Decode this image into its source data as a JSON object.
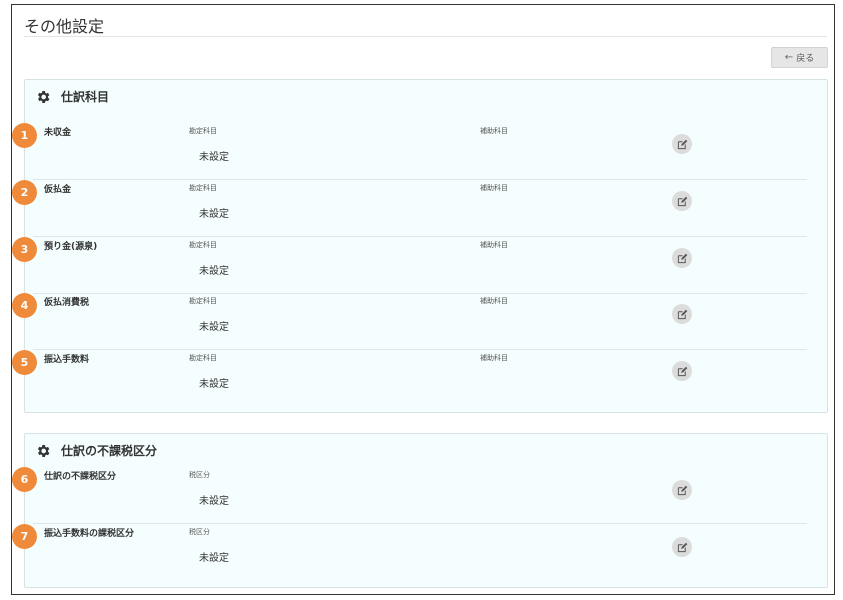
{
  "page": {
    "title": "その他設定"
  },
  "toolbar": {
    "back_label": "戻る"
  },
  "sections": [
    {
      "title": "仕訳科目",
      "icon": "gear-icon",
      "items": [
        {
          "number": "1",
          "label": "未収金",
          "account_label": "勘定科目",
          "account_value": "未設定",
          "sub_label": "補助科目",
          "sub_value": ""
        },
        {
          "number": "2",
          "label": "仮払金",
          "account_label": "勘定科目",
          "account_value": "未設定",
          "sub_label": "補助科目",
          "sub_value": ""
        },
        {
          "number": "3",
          "label": "預り金(源泉)",
          "account_label": "勘定科目",
          "account_value": "未設定",
          "sub_label": "補助科目",
          "sub_value": ""
        },
        {
          "number": "4",
          "label": "仮払消費税",
          "account_label": "勘定科目",
          "account_value": "未設定",
          "sub_label": "補助科目",
          "sub_value": ""
        },
        {
          "number": "5",
          "label": "振込手数料",
          "account_label": "勘定科目",
          "account_value": "未設定",
          "sub_label": "補助科目",
          "sub_value": ""
        }
      ]
    },
    {
      "title": "仕訳の不課税区分",
      "icon": "gear-icon",
      "items": [
        {
          "number": "6",
          "label": "仕訳の不課税区分",
          "tax_label": "税区分",
          "tax_value": "未設定"
        },
        {
          "number": "7",
          "label": "振込手数料の課税区分",
          "tax_label": "税区分",
          "tax_value": "未設定"
        }
      ]
    }
  ],
  "colors": {
    "badge": "#ee8a3a",
    "panel_bg": "#f5fefe",
    "edit_bg": "#dcdcdc"
  }
}
